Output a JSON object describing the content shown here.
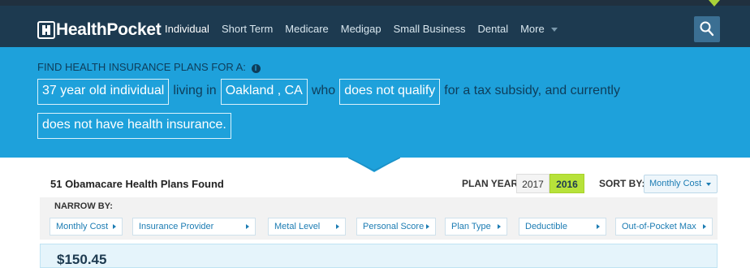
{
  "brand": {
    "name": "HealthPocket"
  },
  "nav": {
    "items": [
      "Individual",
      "Short Term",
      "Medicare",
      "Medigap",
      "Small Business",
      "Dental",
      "More"
    ],
    "active": "Individual"
  },
  "hero": {
    "title": "FIND HEALTH INSURANCE PLANS FOR A:",
    "info_glyph": "i",
    "age_chip": "37 year old individual",
    "living_in": "living in",
    "location_chip": "Oakland , CA",
    "who": "who",
    "subsidy_chip": "does not qualify",
    "subsidy_text": "for a tax subsidy, and currently",
    "insurance_chip": "does not have health insurance."
  },
  "results": {
    "count_text": "51 Obamacare Health Plans Found",
    "plan_year_label": "PLAN YEAR:",
    "years": [
      "2017",
      "2016"
    ],
    "selected_year": "2016",
    "sort_label": "SORT BY:",
    "sort_value": "Monthly Cost"
  },
  "filters": {
    "label": "NARROW BY:",
    "items": [
      "Monthly Cost",
      "Insurance Provider",
      "Metal Level",
      "Personal Score",
      "Plan Type",
      "Deductible",
      "Out-of-Pocket Max"
    ]
  },
  "card": {
    "price": "$150.45"
  },
  "colors": {
    "nav_bg": "#1d3a50",
    "hero_bg": "#1ea1db",
    "accent_green": "#b7e23a",
    "link_blue": "#1c7cb3"
  }
}
